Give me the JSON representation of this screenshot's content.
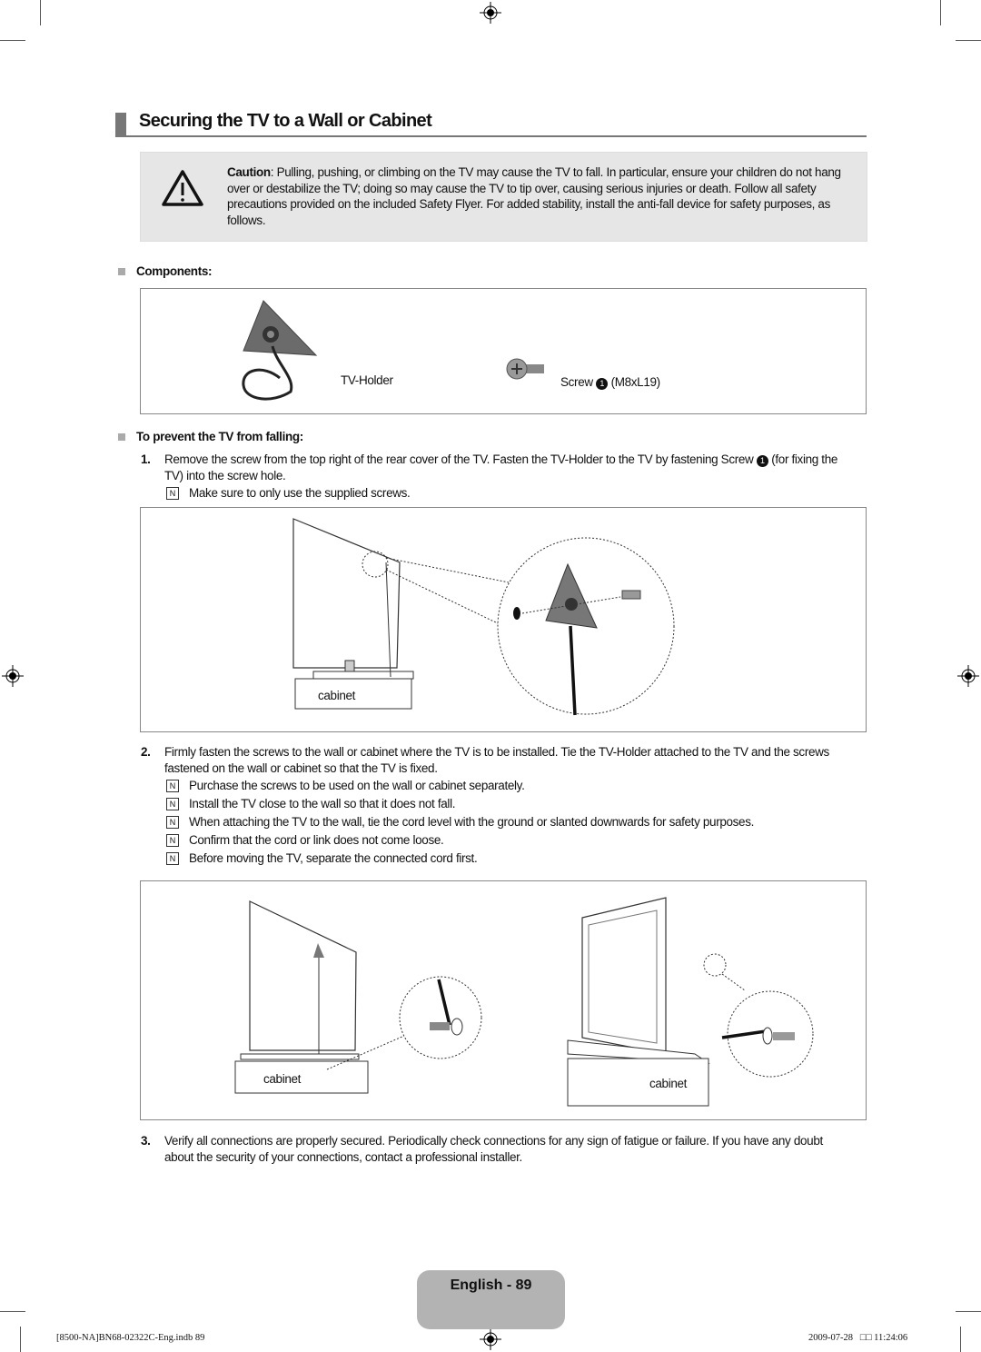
{
  "title": "Securing the TV to a Wall or Cabinet",
  "caution": {
    "label": "Caution",
    "text": ": Pulling, pushing, or climbing on the TV may cause the TV to fall. In particular, ensure your children do not hang over or destabilize the TV; doing so may cause the TV to tip over, causing serious injuries or death. Follow all safety precautions provided on the included Safety Flyer. For added stability, install the anti-fall device for safety purposes, as follows."
  },
  "components": {
    "heading": "Components:",
    "holder_label": "TV-Holder",
    "screw_label": "Screw",
    "screw_num": "1",
    "screw_spec": "(M8xL19)"
  },
  "prevent_heading": "To prevent the TV from falling:",
  "steps": [
    {
      "num": "1.",
      "text_a": "Remove the screw from the top right of the rear cover of the TV. Fasten the TV-Holder to the TV by fastening Screw ",
      "circle": "1",
      "text_b": " (for fixing the TV) into the screw hole.",
      "notes": [
        "Make sure to only use the supplied screws."
      ]
    },
    {
      "num": "2.",
      "text": "Firmly fasten the screws to the wall or cabinet where the TV is to be installed. Tie the TV-Holder attached to the TV and the screws fastened on the wall or cabinet so that the TV is fixed.",
      "notes": [
        "Purchase the screws to be used on the wall or cabinet separately.",
        "Install the TV close to the wall so that it does not fall.",
        "When attaching the TV to the wall, tie the cord level with the ground or slanted downwards for safety purposes.",
        "Confirm that the cord or link does not come loose.",
        "Before moving the TV, separate the connected cord first."
      ]
    },
    {
      "num": "3.",
      "text": "Verify all connections are properly secured. Periodically check connections for any sign of fatigue or failure. If you have any doubt about the security of your connections, contact a professional installer."
    }
  ],
  "note_glyph": "N",
  "figure_labels": {
    "cabinet": "cabinet"
  },
  "footer": {
    "page_tab": "English - 89",
    "file": "[8500-NA]BN68-02322C-Eng.indb   89",
    "timestamp": "2009-07-28   □□ 11:24:06"
  }
}
